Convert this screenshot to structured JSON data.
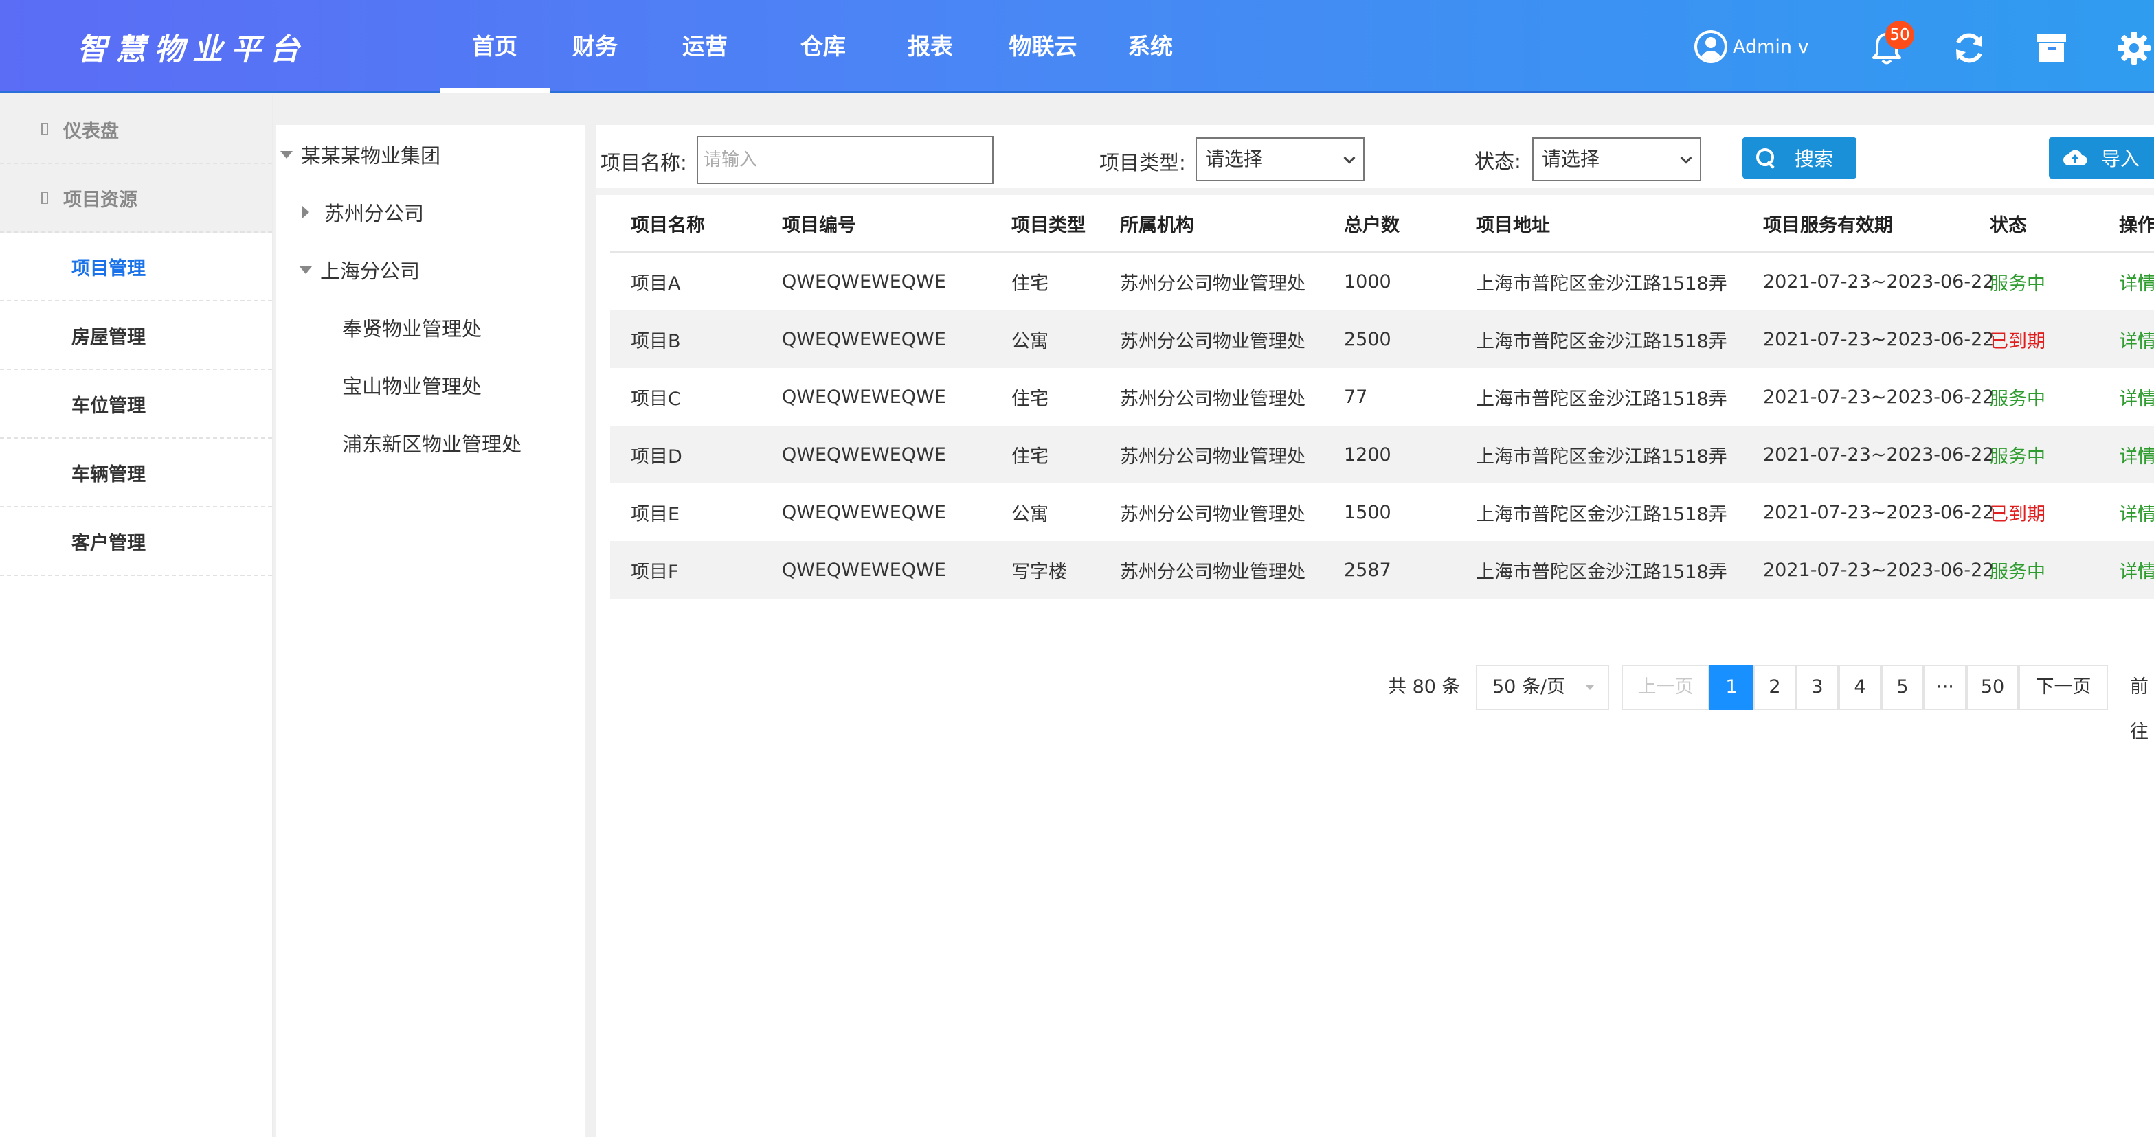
{
  "app": {
    "title": "智慧物业平台"
  },
  "topnav": {
    "items": [
      "首页",
      "财务",
      "运营",
      "仓库",
      "报表",
      "物联云",
      "系统"
    ],
    "active_index": 0
  },
  "header": {
    "user": "Admin v",
    "notification_count": "50"
  },
  "sidebar": {
    "groups": [
      {
        "label": "仪表盘"
      },
      {
        "label": "项目资源"
      }
    ],
    "items": [
      "项目管理",
      "房屋管理",
      "车位管理",
      "车辆管理",
      "客户管理"
    ],
    "active_item": "项目管理"
  },
  "tree": {
    "root": "某某某物业集团",
    "children": [
      "苏州分公司",
      "上海分公司"
    ],
    "shanghai_children": [
      "奉贤物业管理处",
      "宝山物业管理处",
      "浦东新区物业管理处"
    ]
  },
  "filters": {
    "name_label": "项目名称:",
    "name_placeholder": "请输入",
    "type_label": "项目类型:",
    "type_value": "请选择",
    "status_label": "状态:",
    "status_value": "请选择",
    "search_label": "搜索",
    "import_label": "导入"
  },
  "table": {
    "headers": [
      "项目名称",
      "项目编号",
      "项目类型",
      "所属机构",
      "总户数",
      "项目地址",
      "项目服务有效期",
      "状态",
      "操作"
    ],
    "rows": [
      [
        "项目A",
        "QWEQWEWEQWE",
        "住宅",
        "苏州分公司物业管理处",
        "1000",
        "上海市普陀区金沙江路1518弄",
        "2021-07-23~2023-06-22",
        "服务中",
        "详情"
      ],
      [
        "项目B",
        "QWEQWEWEQWE",
        "公寓",
        "苏州分公司物业管理处",
        "2500",
        "上海市普陀区金沙江路1518弄",
        "2021-07-23~2023-06-22",
        "已到期",
        "详情"
      ],
      [
        "项目C",
        "QWEQWEWEQWE",
        "住宅",
        "苏州分公司物业管理处",
        "77",
        "上海市普陀区金沙江路1518弄",
        "2021-07-23~2023-06-22",
        "服务中",
        "详情"
      ],
      [
        "项目D",
        "QWEQWEWEQWE",
        "住宅",
        "苏州分公司物业管理处",
        "1200",
        "上海市普陀区金沙江路1518弄",
        "2021-07-23~2023-06-22",
        "服务中",
        "详情"
      ],
      [
        "项目E",
        "QWEQWEWEQWE",
        "公寓",
        "苏州分公司物业管理处",
        "1500",
        "上海市普陀区金沙江路1518弄",
        "2021-07-23~2023-06-22",
        "已到期",
        "详情"
      ],
      [
        "项目F",
        "QWEQWEWEQWE",
        "写字楼",
        "苏州分公司物业管理处",
        "2587",
        "上海市普陀区金沙江路1518弄",
        "2021-07-23~2023-06-22",
        "服务中",
        "详情"
      ]
    ]
  },
  "pagination": {
    "total": "共 80 条",
    "page_size": "50 条/页",
    "prev": "上一页",
    "pages": [
      "1",
      "2",
      "3",
      "4",
      "5"
    ],
    "ellipsis": "···",
    "last_page": "50",
    "next": "下一页",
    "jump": "前往",
    "current": "1"
  },
  "colors": {
    "header_start": "#5b6cf5",
    "header_end": "#2f9cf0",
    "active": "#1a73e8",
    "status_active": "#2e9c2e",
    "status_expired": "#e02020",
    "button": "#1990d8",
    "page_current": "#1990ff"
  }
}
